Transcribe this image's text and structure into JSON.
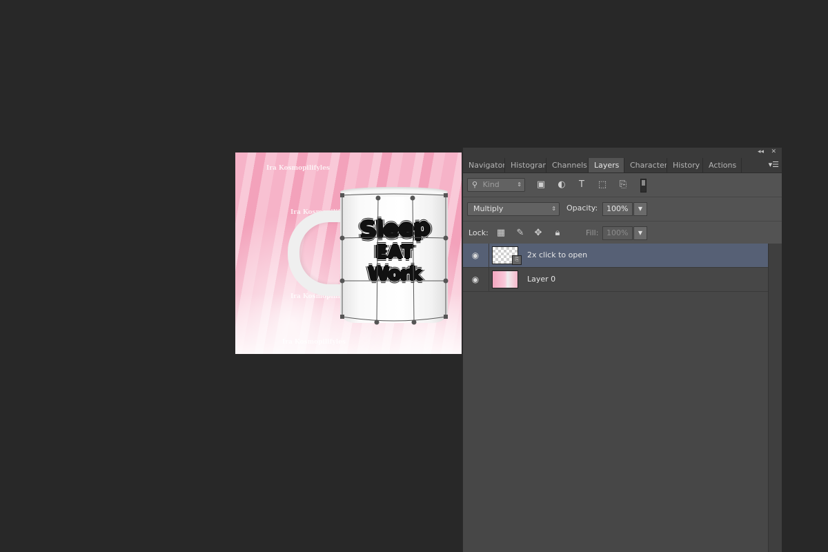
{
  "canvas": {
    "watermarks": [
      "Ira Kosmopilifyles",
      "Ira Kosmopilifyles",
      "Ira Kosmopilifyles",
      "Ira Kosmopilifyles"
    ],
    "mug_text": [
      "Sleep",
      "EAT",
      "Work"
    ]
  },
  "panel": {
    "top_controls": {
      "collapse": "◂◂",
      "close": "✕"
    },
    "tabs": [
      "Navigator",
      "Histogram",
      "Channels",
      "Layers",
      "Character",
      "History",
      "Actions"
    ],
    "active_tab": "Layers",
    "menu_icon": "panel-menu-icon",
    "filter": {
      "label": "Kind",
      "icon": "search-icon"
    },
    "blend_mode": "Multiply",
    "opacity_label": "Opacity:",
    "opacity_value": "100%",
    "lock_label": "Lock:",
    "fill_label": "Fill:",
    "fill_value": "100%",
    "layers": [
      {
        "name": "2x click to open",
        "selected": true,
        "thumb": "smart-object"
      },
      {
        "name": "Layer 0",
        "selected": false,
        "thumb": "image"
      }
    ]
  },
  "colors": {
    "background": "#282828",
    "panel": "#535353",
    "selected_layer": "#566075"
  }
}
